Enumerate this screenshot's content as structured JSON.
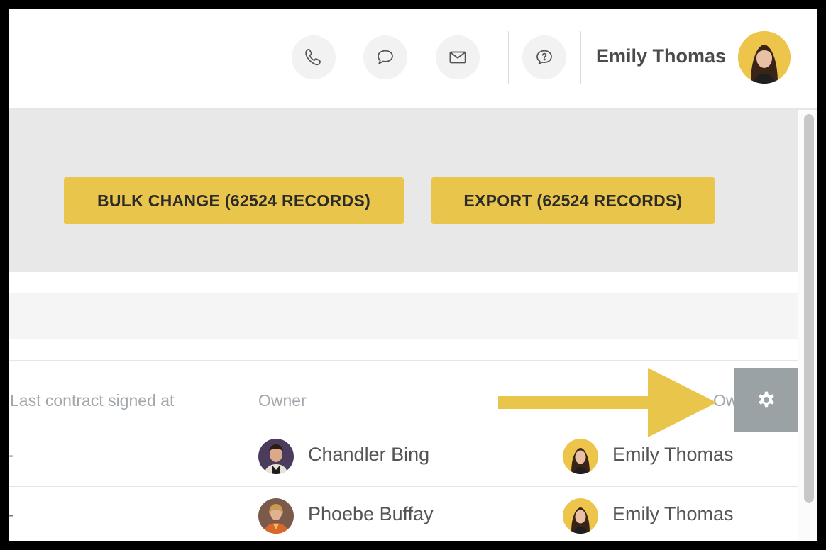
{
  "header": {
    "user_name": "Emily Thomas",
    "icons": [
      "phone-icon",
      "chat-icon",
      "mail-icon",
      "help-icon"
    ]
  },
  "actions": {
    "bulk_change_label": "BULK CHANGE (62524 RECORDS)",
    "export_label": "EXPORT (62524 RECORDS)"
  },
  "table": {
    "columns": [
      "Last contract signed at",
      "Owner",
      "Ow"
    ],
    "rows": [
      {
        "last_contract": "-",
        "owner": "Chandler Bing",
        "owner2": "Emily Thomas"
      },
      {
        "last_contract": "-",
        "owner": "Phoebe Buffay",
        "owner2": "Emily Thomas"
      }
    ]
  },
  "colors": {
    "accent": "#eac54c",
    "gear_button": "#9aa2a6",
    "band": "#e8e8e8"
  }
}
